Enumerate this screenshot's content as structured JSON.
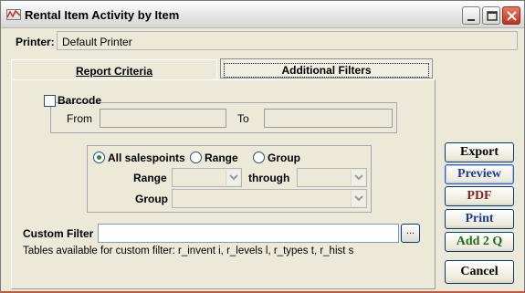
{
  "window": {
    "title": "Rental Item Activity by Item",
    "controls": {
      "minimize": "minimize-icon",
      "maximize": "maximize-icon",
      "close": "close-icon"
    }
  },
  "printer": {
    "label": "Printer:",
    "value": "Default Printer"
  },
  "tabs": [
    {
      "label": "Report Criteria",
      "active": false
    },
    {
      "label": "Additional Filters",
      "active": true
    }
  ],
  "barcode": {
    "label": "Barcode",
    "checked": false,
    "from_label": "From",
    "to_label": "To",
    "from_value": "",
    "to_value": ""
  },
  "salespoints": {
    "options": [
      {
        "label": "All salespoints",
        "selected": true
      },
      {
        "label": "Range",
        "selected": false
      },
      {
        "label": "Group",
        "selected": false
      }
    ],
    "range_label": "Range",
    "through_label": "through",
    "group_label": "Group",
    "range_from": "",
    "range_through": "",
    "group_value": ""
  },
  "custom_filter": {
    "label": "Custom Filter",
    "value": "",
    "button_label": "...",
    "tables_note": "Tables available for custom filter: r_invent i, r_levels l, r_types t, r_hist s"
  },
  "buttons": {
    "export": "Export",
    "preview": "Preview",
    "pdf": "PDF",
    "print": "Print",
    "add2q": "Add 2 Q",
    "cancel": "Cancel"
  },
  "colors": {
    "accent_blue": "#1b3b9a",
    "pdf_red": "#8b1f1f",
    "add_green": "#1d6b1d",
    "background": "#ece9d8"
  }
}
